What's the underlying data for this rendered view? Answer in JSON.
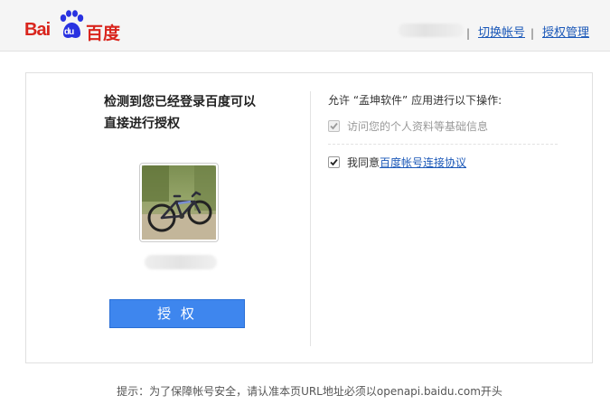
{
  "header": {
    "logo_text_latin": "Bai",
    "logo_text_du": "du",
    "logo_text_cn": "百度",
    "separator": "|",
    "switch_account": "切换帐号",
    "auth_manage": "授权管理"
  },
  "left": {
    "title": "检测到您已经登录百度可以直接进行授权",
    "authorize_button": "授 权"
  },
  "right": {
    "heading": "允许 “孟坤软件” 应用进行以下操作:",
    "permissions": [
      {
        "label": "访问您的个人资料等基础信息",
        "checked": true,
        "disabled": true
      },
      {
        "label": "我同意",
        "link": "百度帐号连接协议",
        "checked": true,
        "disabled": false
      }
    ]
  },
  "footer": {
    "tip": "提示：为了保障帐号安全，请认准本页URL地址必须以openapi.baidu.com开头"
  },
  "colors": {
    "brand_red": "#d9251d",
    "brand_blue": "#2932e1",
    "button_blue": "#3e86ee",
    "link_blue": "#1b58b8"
  }
}
